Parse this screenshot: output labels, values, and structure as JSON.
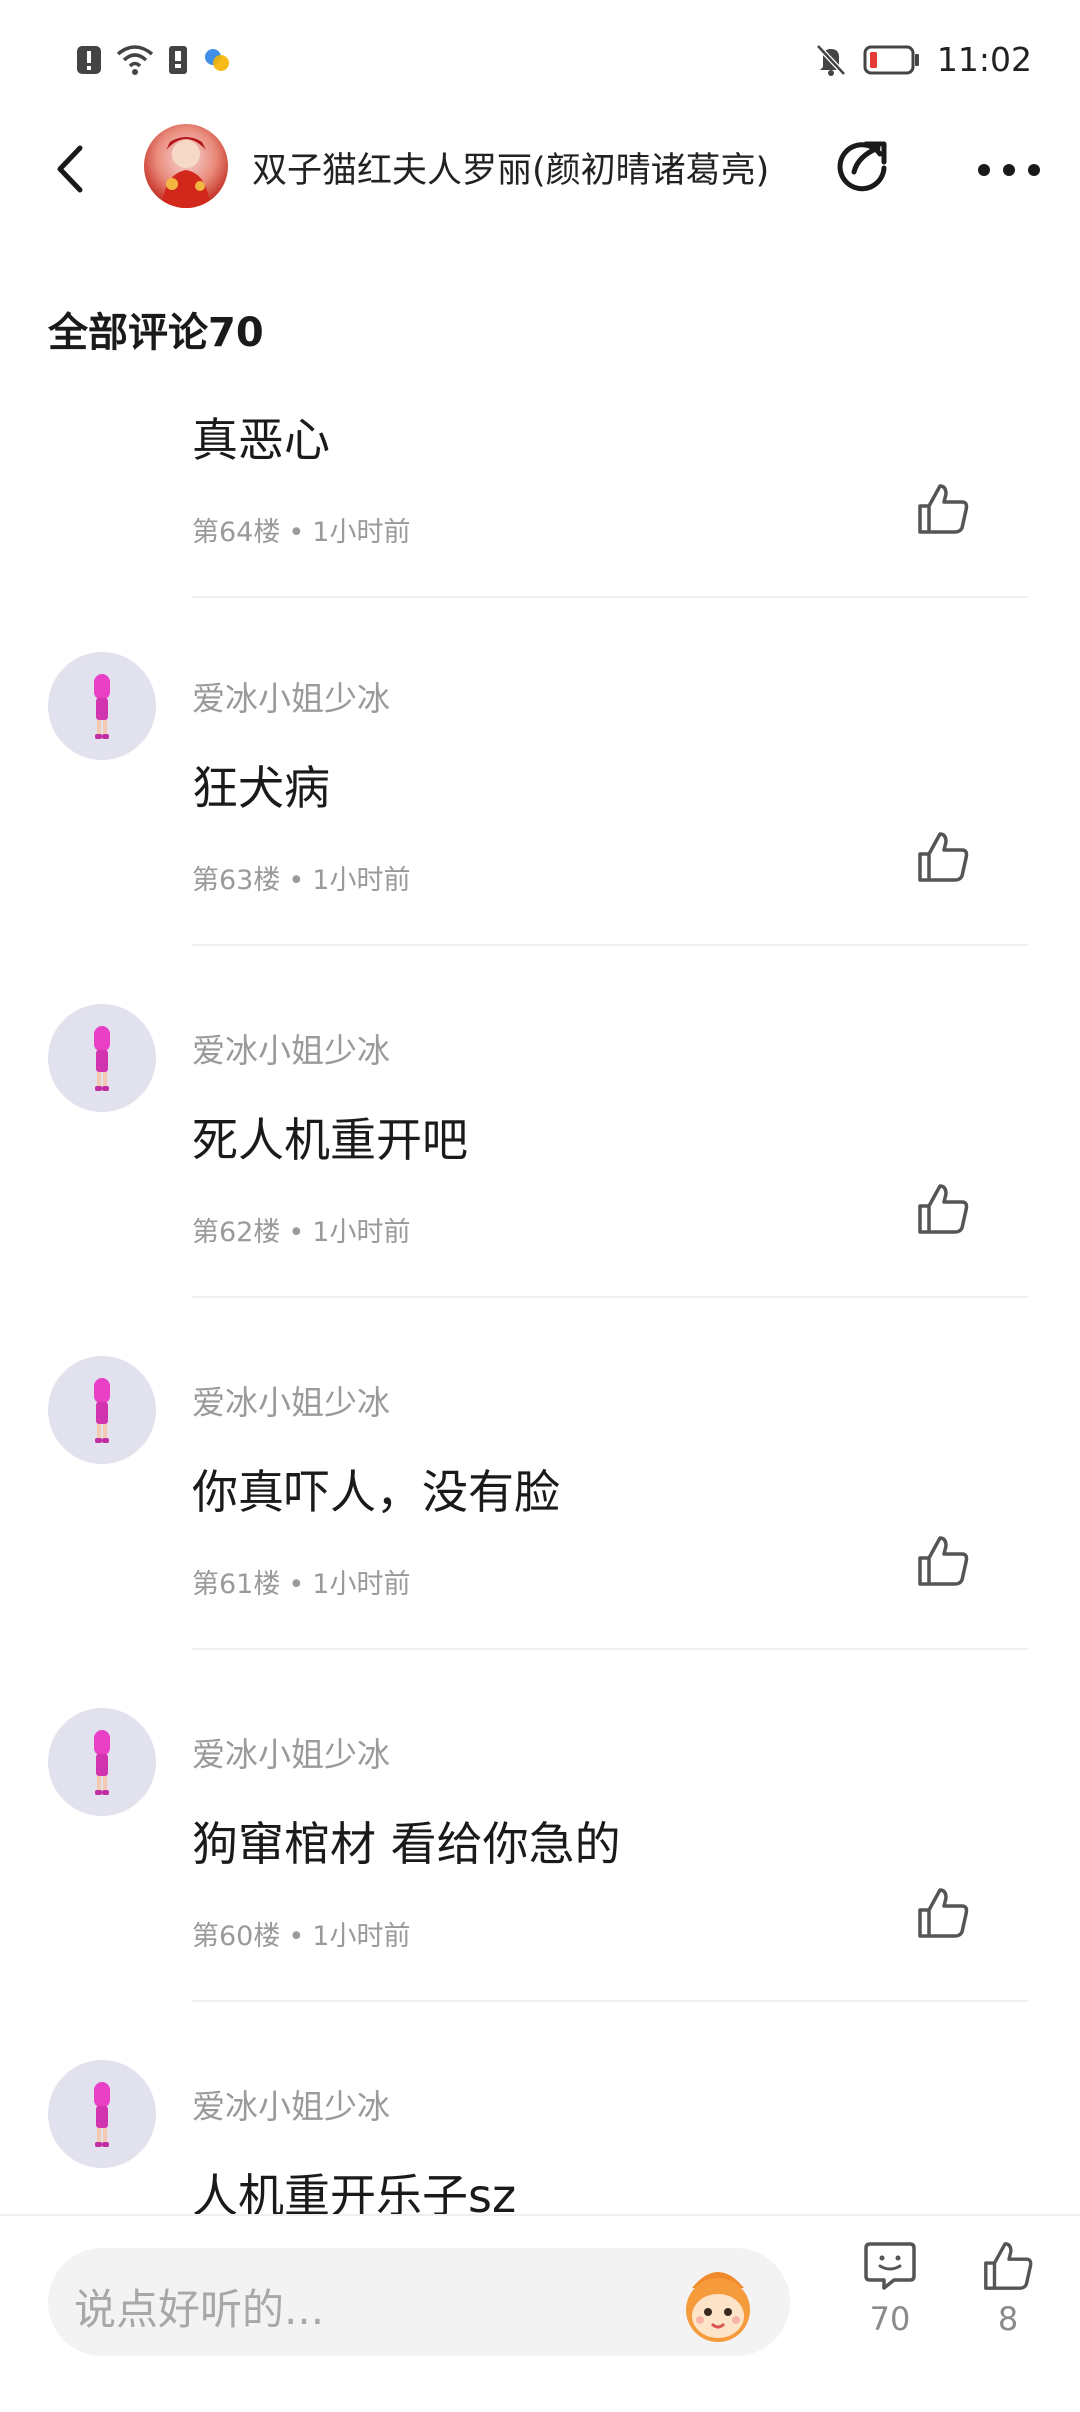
{
  "status_bar": {
    "time": "11:02",
    "icons": [
      "notification-icon",
      "wifi-icon",
      "sim-icon",
      "app-icon",
      "mute-icon",
      "battery-icon"
    ]
  },
  "header": {
    "title": "双子猫红夫人罗丽(颜初晴诸葛亮)"
  },
  "comments_section": {
    "title": "全部评论70"
  },
  "comments": [
    {
      "username": "",
      "text": "真恶心",
      "floor": "第64楼",
      "time": "1小时前"
    },
    {
      "username": "爱冰小姐少冰",
      "text": "狂犬病",
      "floor": "第63楼",
      "time": "1小时前"
    },
    {
      "username": "爱冰小姐少冰",
      "text": "死人机重开吧",
      "floor": "第62楼",
      "time": "1小时前"
    },
    {
      "username": "爱冰小姐少冰",
      "text": "你真吓人，没有脸",
      "floor": "第61楼",
      "time": "1小时前"
    },
    {
      "username": "爱冰小姐少冰",
      "text": "狗窜棺材 看给你急的",
      "floor": "第60楼",
      "time": "1小时前"
    },
    {
      "username": "爱冰小姐少冰",
      "text": "人机重开乐子sz",
      "floor": "",
      "time": ""
    }
  ],
  "bottom_bar": {
    "input_placeholder": "说点好听的...",
    "comment_count": "70",
    "like_count": "8"
  },
  "colors": {
    "accent_pink": "#e83fc4",
    "text_primary": "#1a1a1a",
    "text_secondary": "#9a9a9a",
    "battery_low": "#e53935"
  }
}
